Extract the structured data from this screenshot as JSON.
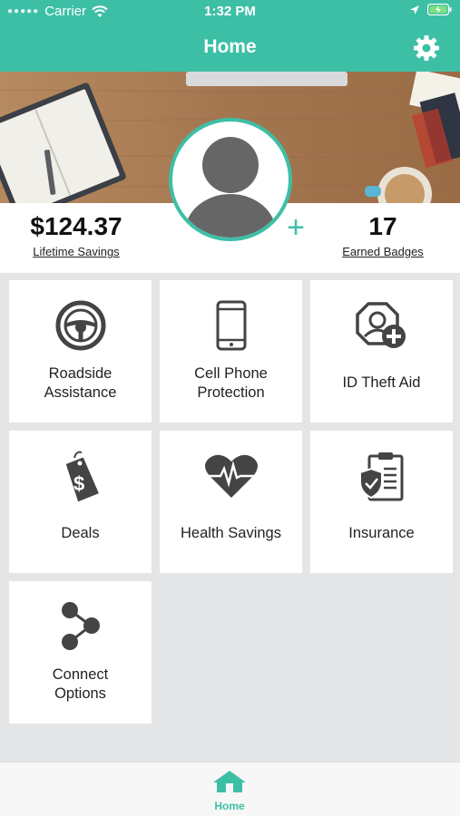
{
  "status_bar": {
    "carrier": "Carrier",
    "time": "1:32 PM"
  },
  "header": {
    "title": "Home",
    "settings_icon": "gear-icon"
  },
  "profile": {
    "savings_value": "$124.37",
    "savings_label": "Lifetime Savings",
    "badges_value": "17",
    "badges_label": "Earned Badges",
    "add_symbol": "+"
  },
  "tiles": [
    {
      "label_line1": "Roadside",
      "label_line2": "Assistance",
      "icon": "steering-wheel-icon"
    },
    {
      "label_line1": "Cell Phone",
      "label_line2": "Protection",
      "icon": "cell-phone-icon"
    },
    {
      "label_line1": "ID Theft Aid",
      "label_line2": "",
      "icon": "id-theft-icon"
    },
    {
      "label_line1": "Deals",
      "label_line2": "",
      "icon": "price-tag-icon"
    },
    {
      "label_line1": "Health Savings",
      "label_line2": "",
      "icon": "heartbeat-icon"
    },
    {
      "label_line1": "Insurance",
      "label_line2": "",
      "icon": "clipboard-shield-icon"
    },
    {
      "label_line1": "Connect",
      "label_line2": "Options",
      "icon": "share-icon"
    }
  ],
  "tab_bar": {
    "home_label": "Home"
  },
  "colors": {
    "accent": "#3dbfa6",
    "background": "#e4e5e6",
    "icon": "#444444"
  }
}
